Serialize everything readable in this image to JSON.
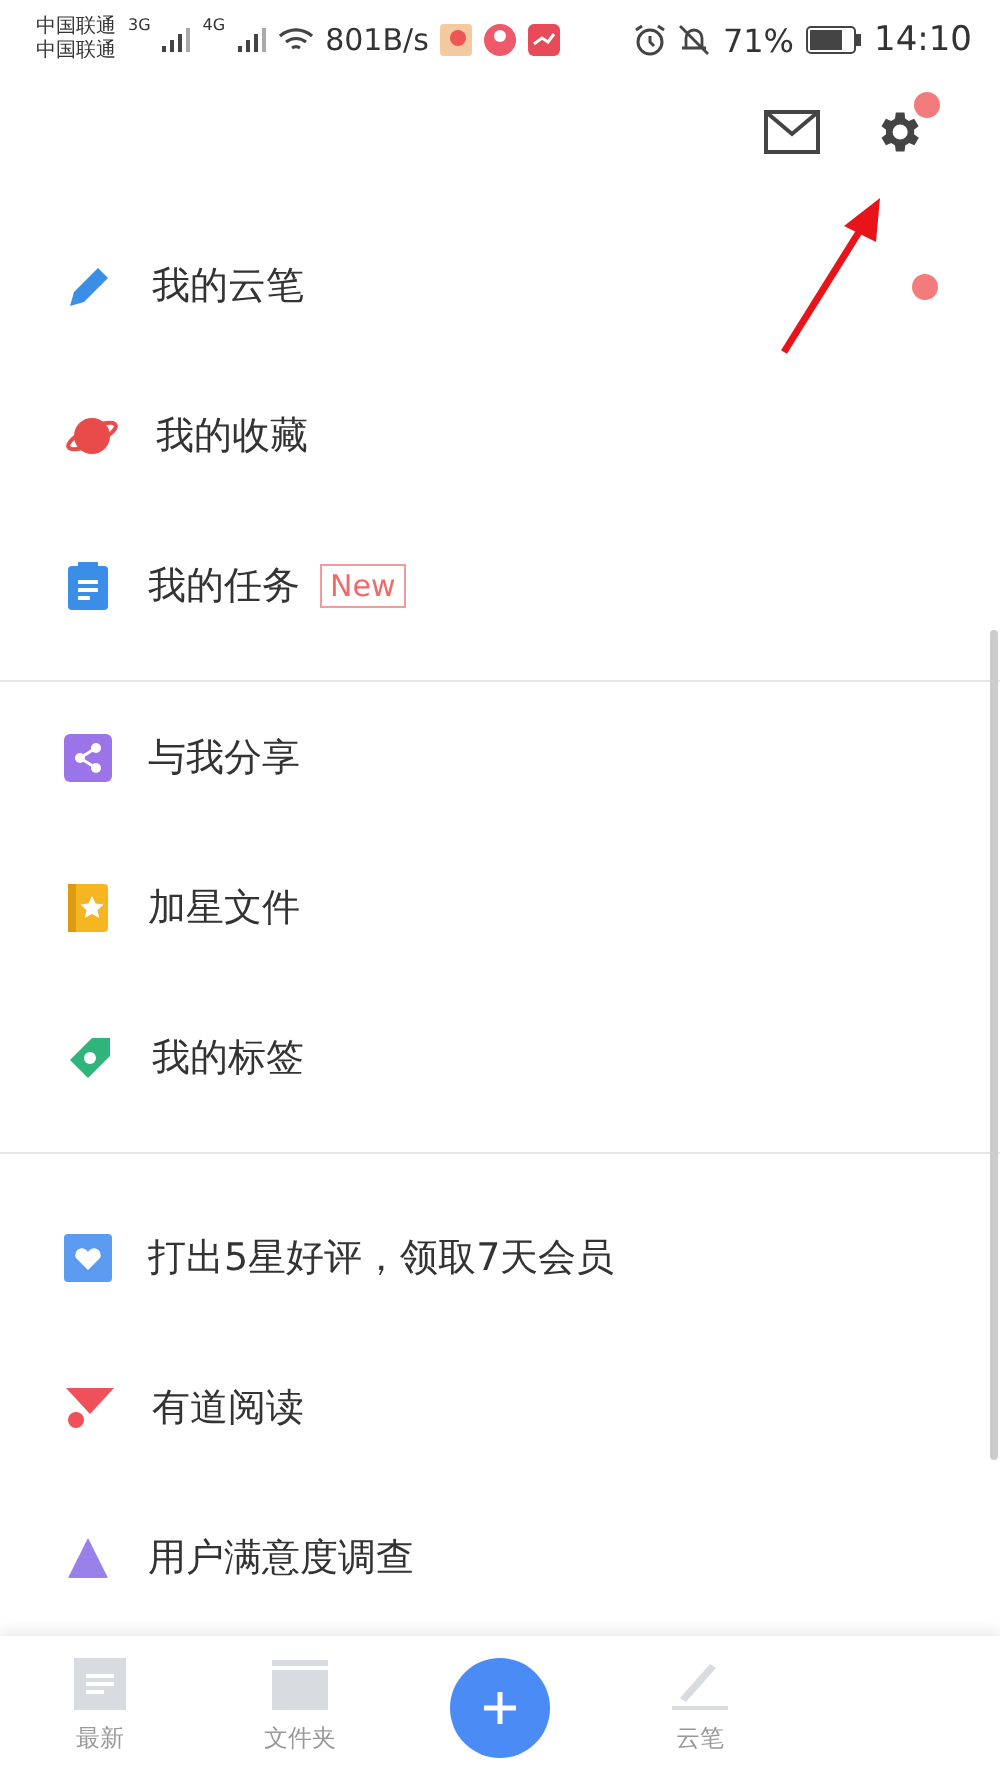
{
  "status_bar": {
    "carriers": [
      "中国联通",
      "中国联通"
    ],
    "networks": [
      "3G",
      "4G"
    ],
    "speed": "801B/s",
    "battery": "71%",
    "time": "14:10"
  },
  "header": {
    "settings_dot": true
  },
  "sections": [
    {
      "items": [
        {
          "kind": "pen",
          "label": "我的云笔",
          "dot": true
        },
        {
          "kind": "planet",
          "label": "我的收藏",
          "dot": false
        },
        {
          "kind": "clipboard",
          "label": "我的任务",
          "badge": "New",
          "dot": false
        }
      ]
    },
    {
      "items": [
        {
          "kind": "share",
          "label": "与我分享",
          "dot": false
        },
        {
          "kind": "star",
          "label": "加星文件",
          "dot": false
        },
        {
          "kind": "tag",
          "label": "我的标签",
          "dot": false
        }
      ]
    },
    {
      "items": [
        {
          "kind": "heart",
          "label": "打出5星好评，领取7天会员",
          "dot": false
        },
        {
          "kind": "read",
          "label": "有道阅读",
          "dot": false
        },
        {
          "kind": "survey",
          "label": "用户满意度调查",
          "dot": false
        }
      ]
    }
  ],
  "bottom_tabs": [
    {
      "kind": "doc",
      "label": "最新"
    },
    {
      "kind": "folder",
      "label": "文件夹"
    },
    {
      "kind": "add"
    },
    {
      "kind": "pen",
      "label": "云笔"
    }
  ]
}
